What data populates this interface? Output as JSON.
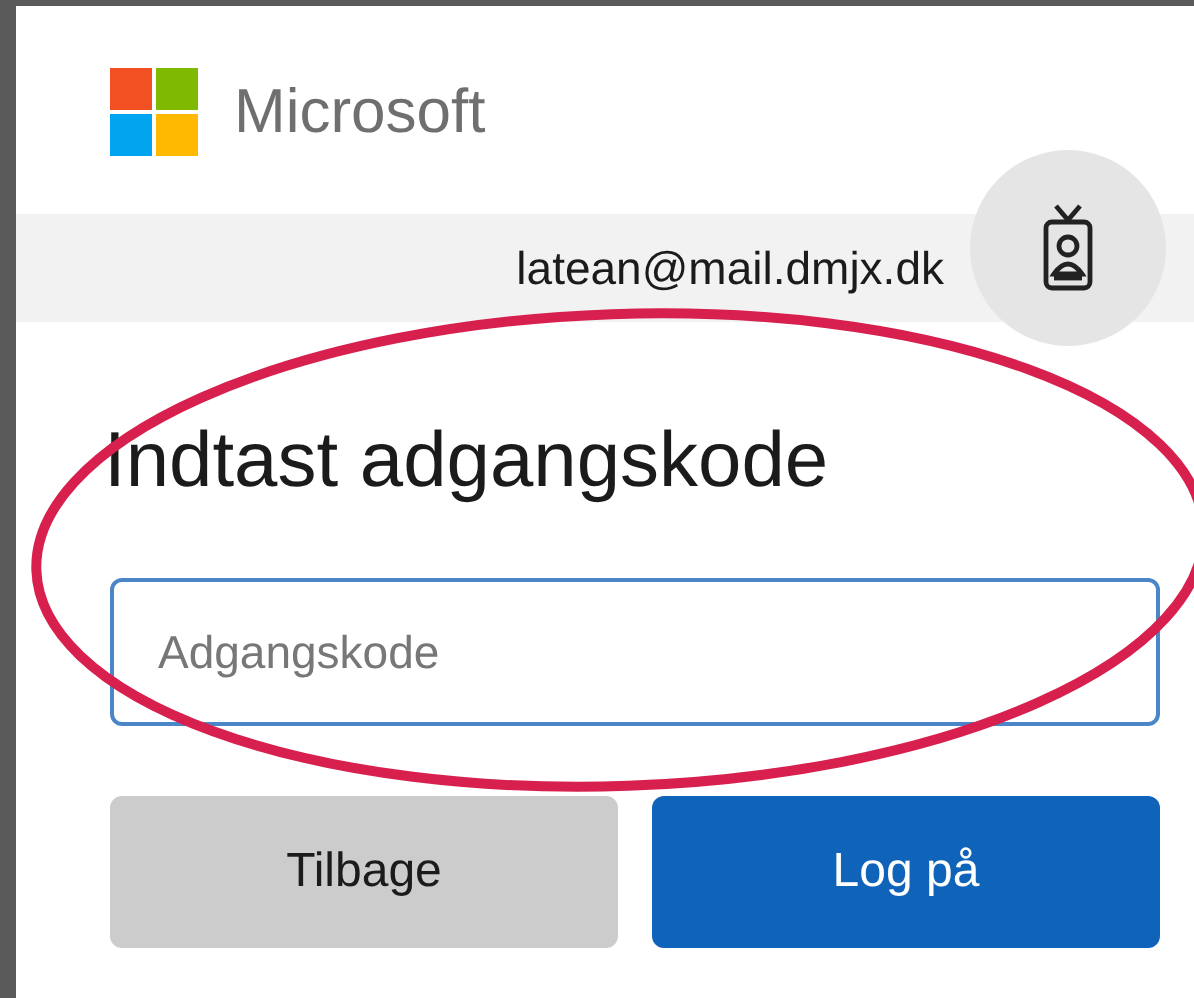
{
  "brand": {
    "name": "Microsoft"
  },
  "account": {
    "email": "latean@mail.dmjx.dk"
  },
  "heading": "Indtast adgangskode",
  "password": {
    "placeholder": "Adgangskode",
    "focused": true
  },
  "buttons": [
    {
      "label": "Tilbage",
      "kind": "secondary"
    },
    {
      "label": "Log på",
      "kind": "primary"
    }
  ],
  "annotation": {
    "kind": "ellipse",
    "color": "#d8204f"
  }
}
